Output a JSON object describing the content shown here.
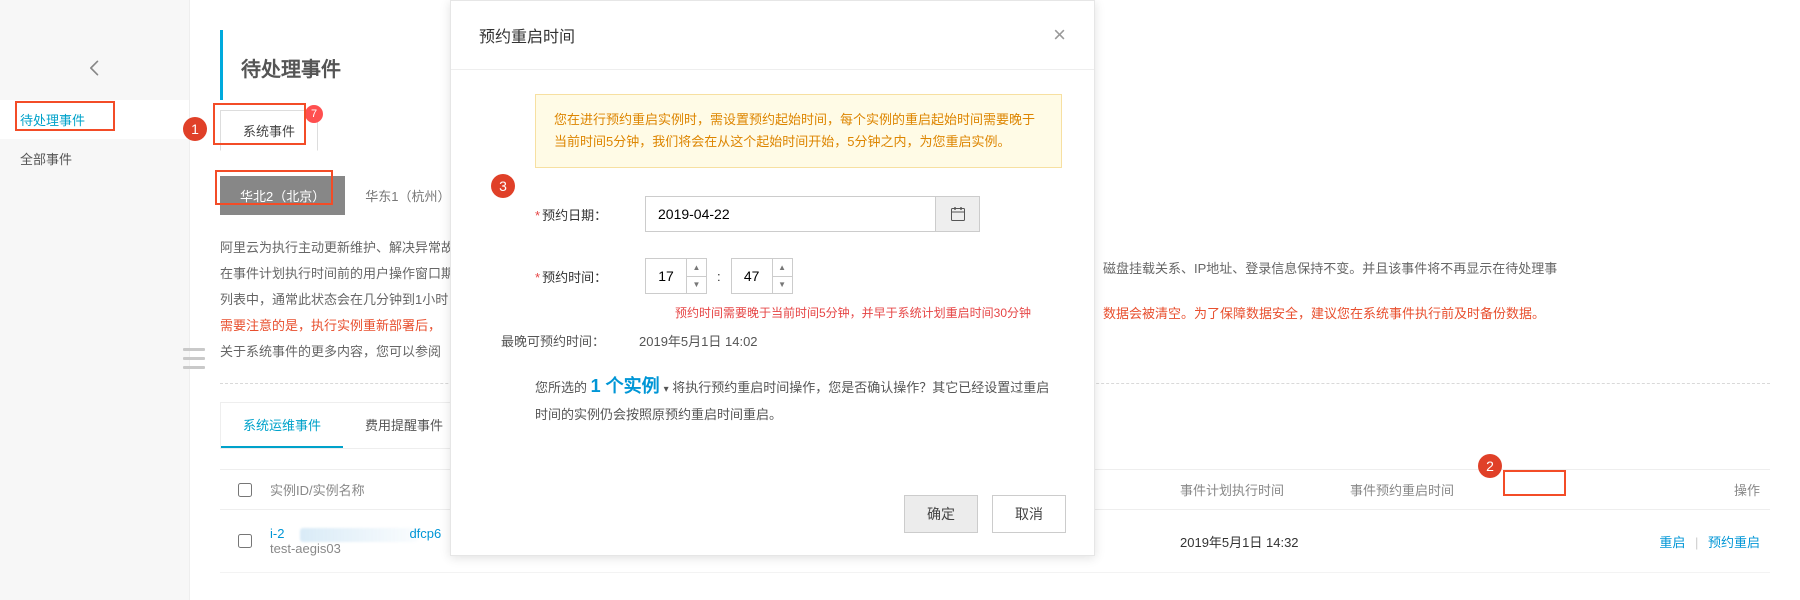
{
  "sidebar": {
    "pending": "待处理事件",
    "all": "全部事件"
  },
  "page_title": "待处理事件",
  "tab": {
    "label": "系统事件",
    "badge": "7"
  },
  "region_tabs": {
    "active": "华北2（北京）",
    "other": "华东1（杭州）"
  },
  "info": {
    "l1": "阿里云为执行主动更新维护、解决异常故",
    "l2": "在事件计划执行时间前的用户操作窗口期",
    "l3": "列表中，通常此状态会在几分钟到1小时",
    "l4": "需要注意的是，执行实例重新部署后，",
    "l5": "关于系统事件的更多内容，您可以参阅"
  },
  "bg_right": {
    "l1": "磁盘挂载关系、IP地址、登录信息保持不变。并且该事件将不再显示在待处理事",
    "l2": "数据会被清空。为了保障数据安全，建议您在系统事件执行前及时备份数据。"
  },
  "sub_tabs": {
    "a": "系统运维事件",
    "b": "费用提醒事件"
  },
  "thead": {
    "chk": "",
    "id": "实例ID/实例名称",
    "plan": "事件计划执行时间",
    "sched": "事件预约重启时间",
    "ops": "操作"
  },
  "row": {
    "id_prefix": "i-2",
    "id_suffix": "dfcp6",
    "name": "test-aegis03",
    "plan_time": "2019年5月1日 14:32",
    "op_restart": "重启",
    "op_schedule": "预约重启"
  },
  "modal": {
    "title": "预约重启时间",
    "alert": "您在进行预约重启实例时，需设置预约起始时间，每个实例的重启起始时间需要晚于当前时间5分钟，我们将会在从这个起始时间开始，5分钟之内，为您重启实例。",
    "date_label": "预约日期：",
    "date_value": "2019-04-22",
    "time_label": "预约时间：",
    "hour": "17",
    "minute": "47",
    "time_hint": "预约时间需要晚于当前时间5分钟，并早于系统计划重启时间30分钟",
    "latest_label": "最晚可预约时间：",
    "latest_value": "2019年5月1日 14:02",
    "confirm_a": "您所选的 ",
    "confirm_count": "1 个实例",
    "confirm_b": " 将执行预约重启时间操作，您是否确认操作？其它已经设置过重启时间的实例仍会按照原预约重启时间重启。",
    "ok": "确定",
    "cancel": "取消"
  },
  "doc_numbers": {
    "one": "1",
    "two": "2",
    "three": "3"
  }
}
